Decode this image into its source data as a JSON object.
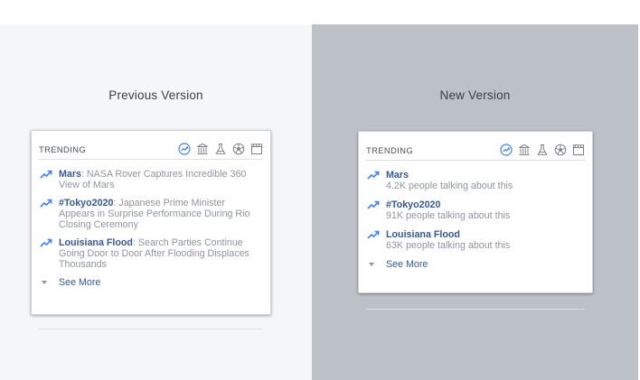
{
  "left": {
    "title": "Previous Version",
    "trending_label": "TRENDING",
    "items": [
      {
        "topic": "Mars",
        "text": ": NASA Rover Captures Incredible 360 View of Mars"
      },
      {
        "topic": "#Tokyo2020",
        "text": ": Japanese Prime Minister Appears in Surprise Performance During Rio Closing Ceremony"
      },
      {
        "topic": "Louisiana Flood",
        "text": ": Search Parties Continue Going Door to Door After Flooding Displaces Thousands"
      }
    ],
    "see_more": "See More"
  },
  "right": {
    "title": "New Version",
    "trending_label": "TRENDING",
    "items": [
      {
        "topic": "Mars",
        "sub": "4.2K people talking about this"
      },
      {
        "topic": "#Tokyo2020",
        "sub": "91K people talking about this"
      },
      {
        "topic": "Louisiana Flood",
        "sub": "63K people talking about this"
      }
    ],
    "see_more": "See More"
  },
  "colors": {
    "link": "#365899",
    "accent": "#4080ff",
    "muted": "#90949c",
    "left_bg": "#f5f6f7",
    "right_bg": "#bcc1c8"
  },
  "category_icons": [
    "trending-icon",
    "politics-icon",
    "science-icon",
    "sports-icon",
    "entertainment-icon"
  ]
}
